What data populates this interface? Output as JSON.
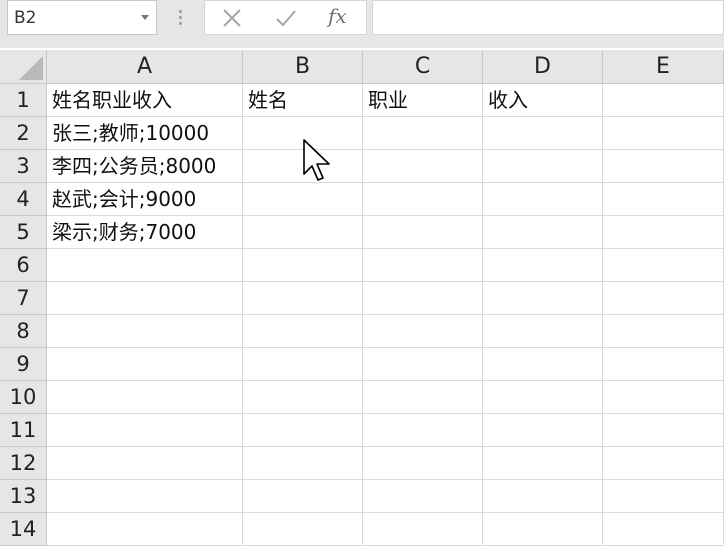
{
  "formula_bar": {
    "name_box": "B2",
    "buttons": [
      "cancel",
      "enter",
      "insert-function"
    ],
    "fx_label": "fx",
    "formula": ""
  },
  "columns": [
    "A",
    "B",
    "C",
    "D",
    "E"
  ],
  "rows": [
    "1",
    "2",
    "3",
    "4",
    "5",
    "6",
    "7",
    "8",
    "9",
    "10",
    "11",
    "12",
    "13",
    "14"
  ],
  "cells": [
    [
      "姓名职业收入",
      "姓名",
      "职业",
      "收入",
      ""
    ],
    [
      "张三;教师;10000",
      "",
      "",
      "",
      ""
    ],
    [
      "李四;公务员;8000",
      "",
      "",
      "",
      ""
    ],
    [
      "赵武;会计;9000",
      "",
      "",
      "",
      ""
    ],
    [
      "梁示;财务;7000",
      "",
      "",
      "",
      ""
    ],
    [
      "",
      "",
      "",
      "",
      ""
    ],
    [
      "",
      "",
      "",
      "",
      ""
    ],
    [
      "",
      "",
      "",
      "",
      ""
    ],
    [
      "",
      "",
      "",
      "",
      ""
    ],
    [
      "",
      "",
      "",
      "",
      ""
    ],
    [
      "",
      "",
      "",
      "",
      ""
    ],
    [
      "",
      "",
      "",
      "",
      ""
    ],
    [
      "",
      "",
      "",
      "",
      ""
    ],
    [
      "",
      "",
      "",
      "",
      ""
    ]
  ],
  "icons": {
    "namebox_dropdown": "chevron-down-icon",
    "cancel": "x-icon",
    "enter": "checkmark-icon",
    "insert_function": "fx-icon",
    "pointer": "mouse-pointer-icon"
  },
  "colors": {
    "header_bg": "#e6e6e6",
    "gridline": "#dadada",
    "toolbar_icon": "#9a9a9a"
  }
}
